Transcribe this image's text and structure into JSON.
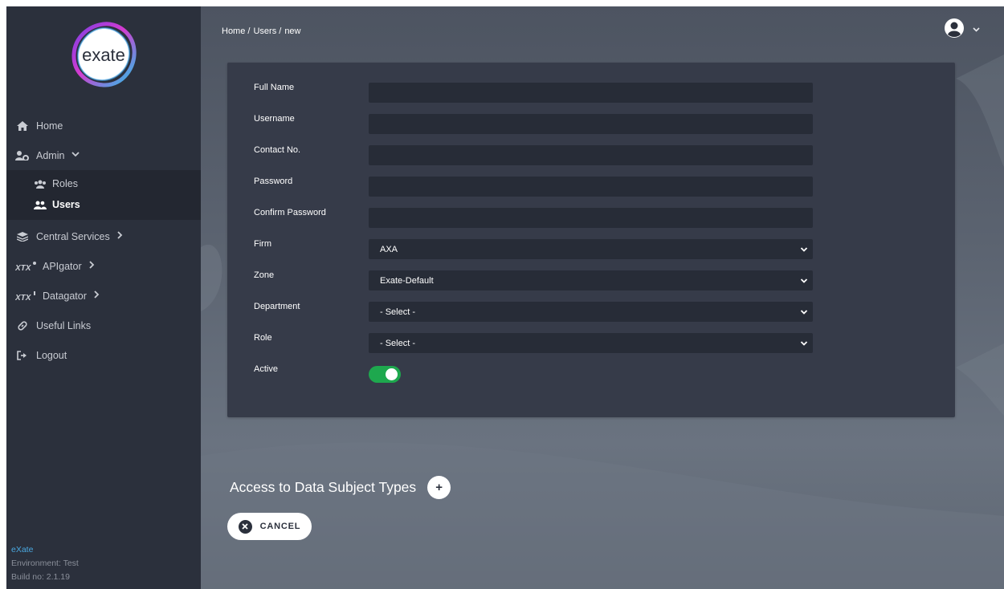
{
  "sidebar": {
    "logo_text": "exate",
    "nav": {
      "home": "Home",
      "admin": "Admin",
      "admin_sub": {
        "roles": "Roles",
        "users": "Users"
      },
      "central_services": "Central Services",
      "apigator": "APIgator",
      "datagator": "Datagator",
      "useful_links": "Useful Links",
      "logout": "Logout"
    },
    "footer": {
      "brand": "eXate",
      "environment": "Environment: Test",
      "build": "Build no: 2.1.19"
    }
  },
  "header": {
    "breadcrumb": {
      "home": "Home /",
      "users": "Users /",
      "current": "new"
    }
  },
  "form": {
    "full_name": {
      "label": "Full Name",
      "value": ""
    },
    "username": {
      "label": "Username",
      "value": ""
    },
    "contact_no": {
      "label": "Contact No.",
      "value": ""
    },
    "password": {
      "label": "Password",
      "value": ""
    },
    "confirm_password": {
      "label": "Confirm Password",
      "value": ""
    },
    "firm": {
      "label": "Firm",
      "value": "AXA"
    },
    "zone": {
      "label": "Zone",
      "value": "Exate-Default"
    },
    "department": {
      "label": "Department",
      "value": "- Select -"
    },
    "role": {
      "label": "Role",
      "value": "- Select -"
    },
    "active": {
      "label": "Active",
      "checked": true
    }
  },
  "access_section": {
    "title": "Access to Data Subject Types",
    "add_symbol": "+"
  },
  "actions": {
    "cancel_label": "CANCEL"
  },
  "colors": {
    "sidebar_bg": "#2b303c",
    "card_bg": "#363b49",
    "input_bg": "#272c37",
    "toggle_on": "#1ea84e",
    "footer_brand": "#4aa8e0"
  }
}
